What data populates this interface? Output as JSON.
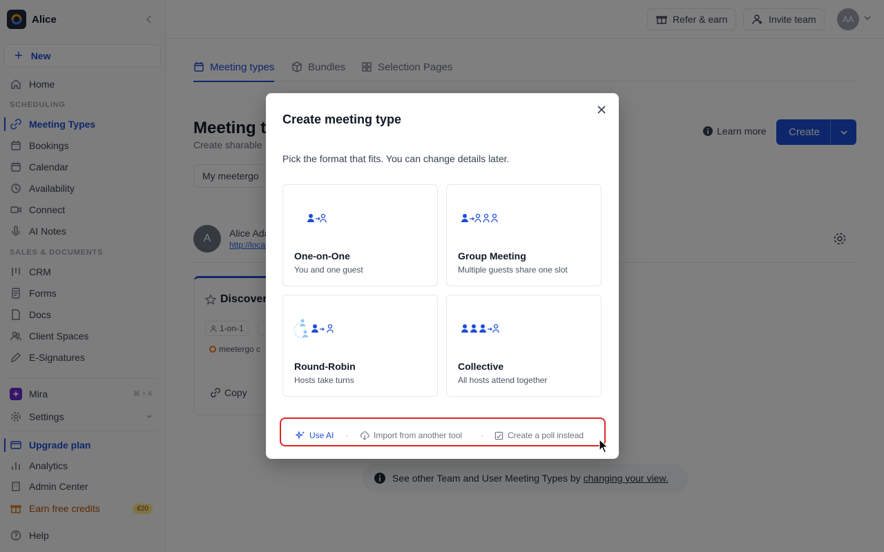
{
  "workspace": {
    "name": "Alice"
  },
  "sidebar": {
    "new_label": "New",
    "home": "Home",
    "section_scheduling": "SCHEDULING",
    "meeting_types": "Meeting Types",
    "bookings": "Bookings",
    "calendar": "Calendar",
    "availability": "Availability",
    "connect": "Connect",
    "ai_notes": "AI Notes",
    "section_sales": "SALES & DOCUMENTS",
    "crm": "CRM",
    "forms": "Forms",
    "docs": "Docs",
    "client_spaces": "Client Spaces",
    "e_signatures": "E-Signatures",
    "mira": "Mira",
    "mira_shortcut": "⌘ + K",
    "settings": "Settings",
    "upgrade": "Upgrade plan",
    "analytics": "Analytics",
    "admin_center": "Admin Center",
    "earn_credits": "Earn free credits",
    "earn_badge": "€20",
    "help": "Help"
  },
  "topbar": {
    "refer": "Refer & earn",
    "invite": "Invite team",
    "avatar_initials": "AA"
  },
  "tabs": {
    "meeting_types": "Meeting types",
    "bundles": "Bundles",
    "selection_pages": "Selection Pages"
  },
  "main": {
    "title": "Meeting types",
    "subtitle": "Create sharable",
    "learn_more": "Learn more",
    "create": "Create",
    "select_value": "My meetergo",
    "user_initial": "A",
    "user_name": "Alice Adams",
    "user_link": "http://localhost",
    "card_title": "Discovery",
    "card_tag": "1-on-1",
    "card_brand": "meetergo c",
    "card_copy": "Copy",
    "banner_text": "See other Team and User Meeting Types by",
    "banner_link": "changing your view."
  },
  "modal": {
    "title": "Create meeting type",
    "subtitle": "Pick the format that fits. You can change details later.",
    "options": [
      {
        "title": "One-on-One",
        "desc": "You and one guest"
      },
      {
        "title": "Group Meeting",
        "desc": "Multiple guests share one slot"
      },
      {
        "title": "Round-Robin",
        "desc": "Hosts take turns"
      },
      {
        "title": "Collective",
        "desc": "All hosts attend together"
      }
    ],
    "use_ai": "Use AI",
    "import": "Import from another tool",
    "poll": "Create a poll instead",
    "separator": "·"
  },
  "colors": {
    "accent": "#1d4ed8",
    "highlight": "#dc2626"
  }
}
